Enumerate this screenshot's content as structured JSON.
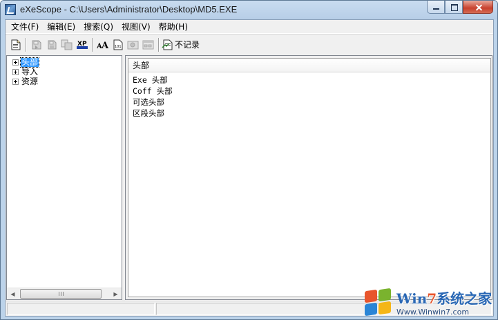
{
  "window": {
    "title": "eXeScope - C:\\Users\\Administrator\\Desktop\\MD5.EXE"
  },
  "menubar": {
    "items": [
      "文件(F)",
      "编辑(E)",
      "搜索(Q)",
      "视图(V)",
      "帮助(H)"
    ]
  },
  "toolbar": {
    "no_record_label": "不记录",
    "buttons": [
      {
        "icon": "new-document-icon",
        "enabled": true
      },
      {
        "icon": "save-icon",
        "enabled": false
      },
      {
        "icon": "save-all-icon",
        "enabled": false
      },
      {
        "icon": "copy-icon",
        "enabled": false
      },
      {
        "icon": "xp-style-icon",
        "enabled": true,
        "text": "XP"
      },
      {
        "icon": "font-icon",
        "enabled": true,
        "text": "AA"
      },
      {
        "icon": "binary-icon",
        "enabled": true,
        "text": "101"
      },
      {
        "icon": "image-icon",
        "enabled": false
      },
      {
        "icon": "dialog-icon",
        "enabled": false
      },
      {
        "icon": "record-icon",
        "enabled": true
      }
    ]
  },
  "tree": {
    "nodes": [
      {
        "label": "头部",
        "selected": true
      },
      {
        "label": "导入",
        "selected": false
      },
      {
        "label": "资源",
        "selected": false
      }
    ]
  },
  "list": {
    "header": "头部",
    "items": [
      "Exe 头部",
      "Coff 头部",
      "可选头部",
      "区段头部"
    ]
  },
  "scrollbar": {
    "grip": "Ⅲ"
  },
  "watermark": {
    "title_a": "Win",
    "title_seven": "7",
    "title_b": "系统之家",
    "url": "Www.Winwin7.com"
  },
  "colors": {
    "selection": "#3399ff",
    "titlebar": "#bcd3ea",
    "close_button": "#c8412e"
  }
}
